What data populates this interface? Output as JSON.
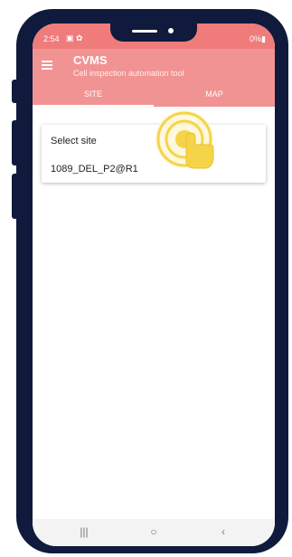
{
  "status": {
    "time": "2:54",
    "icons": "▣ ✿",
    "battery": "0%▮"
  },
  "app": {
    "title": "CVMS",
    "subtitle": "Cell inspection automation tool",
    "menu_icon": "hamburger-menu-icon"
  },
  "tabs": [
    {
      "label": "SITE",
      "active": true
    },
    {
      "label": "MAP",
      "active": false
    }
  ],
  "site_card": {
    "label": "Select site",
    "value": "1089_DEL_P2@R1"
  },
  "nav": {
    "recents": "|||",
    "home": "○",
    "back": "‹"
  },
  "colors": {
    "statusbar": "#f07b7b",
    "appbar": "#f29393",
    "frame": "#0f1a3c",
    "tap_hint": "#f5d44a"
  }
}
